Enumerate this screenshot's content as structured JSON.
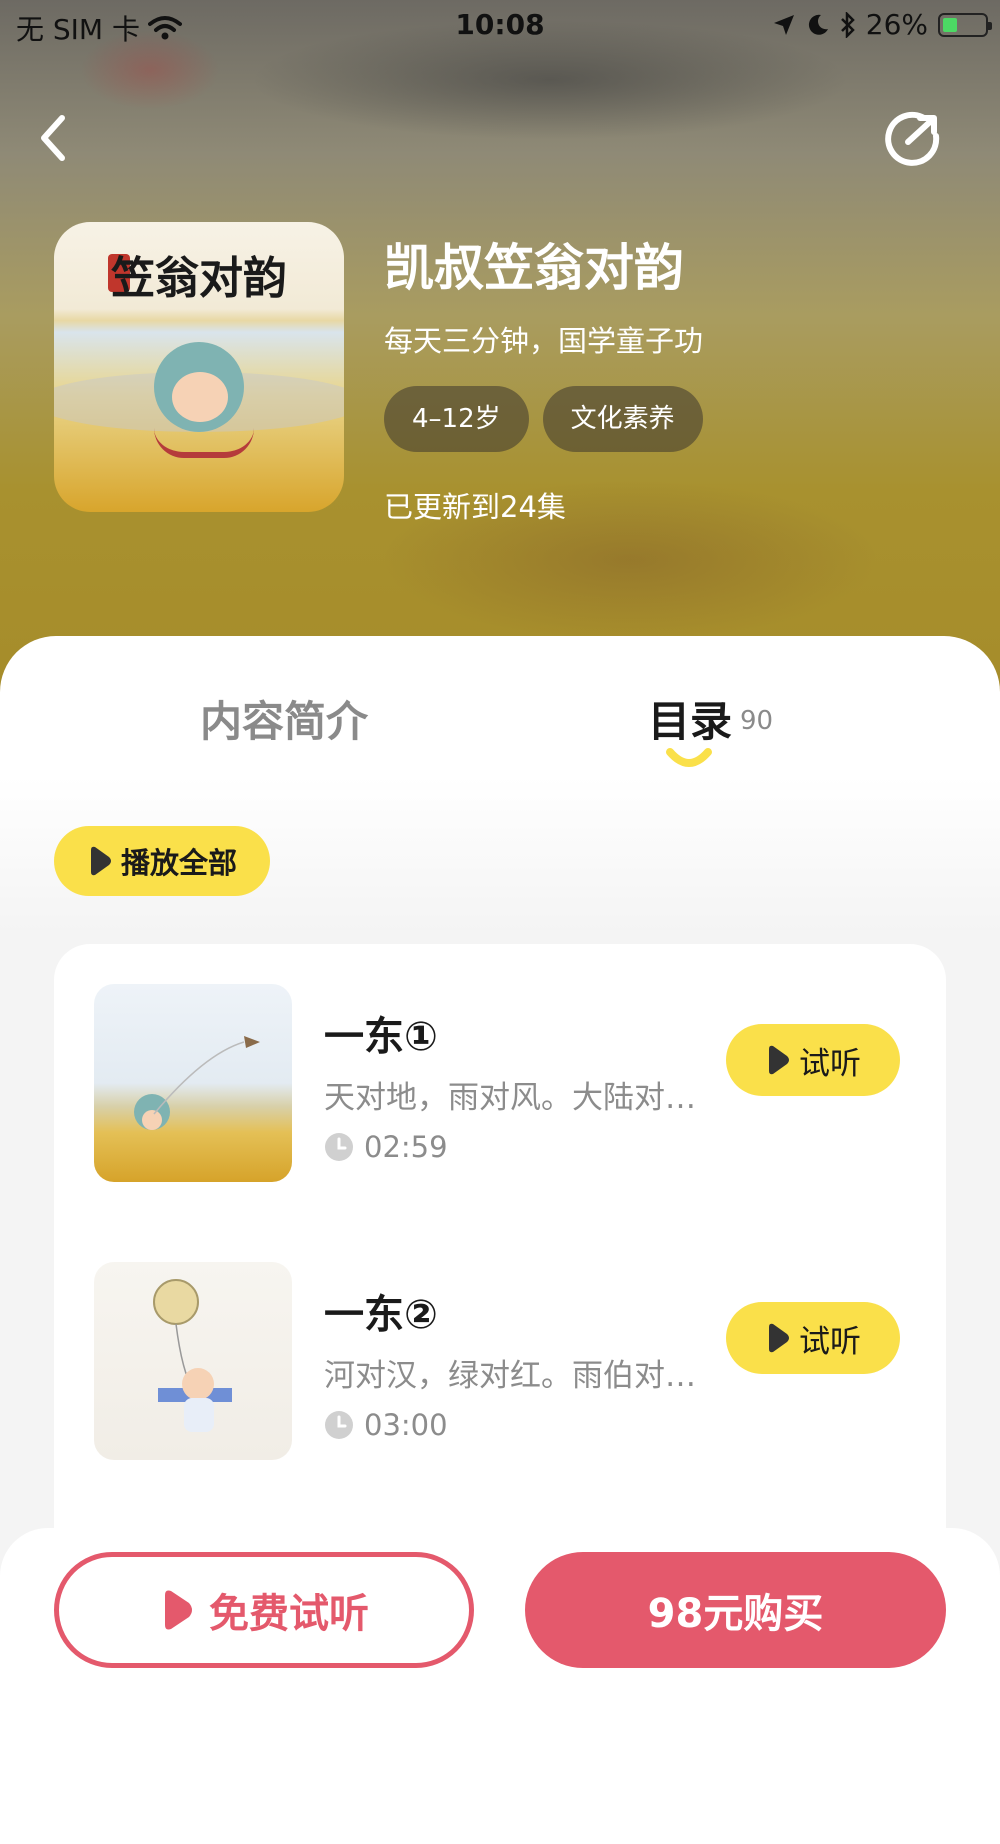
{
  "status_bar": {
    "carrier": "无 SIM 卡",
    "time": "10:08",
    "battery_percent": "26%",
    "icons": [
      "wifi-icon",
      "location-arrow-icon",
      "moon-icon",
      "bluetooth-icon",
      "battery-charging-icon"
    ]
  },
  "header": {
    "back_icon": "chevron-left-icon",
    "share_icon": "share-icon"
  },
  "album": {
    "cover_text": "笠翁对韵",
    "cover_seal": "凯叔",
    "title": "凯叔笠翁对韵",
    "subtitle": "每天三分钟，国学童子功",
    "tags": [
      "4–12岁",
      "文化素养"
    ],
    "updated": "已更新到24集"
  },
  "tabs": {
    "intro_label": "内容简介",
    "catalog_label": "目录",
    "catalog_count": "90",
    "active": "catalog"
  },
  "play_all_label": "播放全部",
  "episodes": [
    {
      "title": "一东①",
      "desc": "天对地，雨对风。大陆对…",
      "duration": "02:59",
      "button": "试听"
    },
    {
      "title": "一东②",
      "desc": "河对汉，绿对红。雨伯对…",
      "duration": "03:00",
      "button": "试听"
    }
  ],
  "bottom": {
    "free_label": "免费试听",
    "buy_label": "98元购买"
  },
  "colors": {
    "accent_yellow": "#fae04a",
    "accent_red": "#e4596c",
    "text_dark": "#1a1a1a",
    "text_gray": "#8c8c8c"
  }
}
